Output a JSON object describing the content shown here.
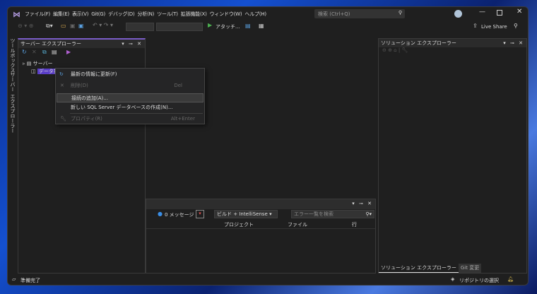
{
  "menu": [
    "ファイル(F)",
    "編集(E)",
    "表示(V)",
    "Git(G)",
    "デバッグ(D)",
    "分析(N)",
    "ツール(T)",
    "拡張機能(X)",
    "ウィンドウ(W)",
    "ヘルプ(H)"
  ],
  "search_placeholder": "検索 (Ctrl+Q)",
  "toolbar": {
    "attach": "アタッチ...",
    "live_share": "Live Share"
  },
  "side_tabs": [
    "ツールボックス",
    "サーバー エクスプローラー"
  ],
  "server_explorer": {
    "title": "サーバー エクスプローラー",
    "tree": [
      "サーバー",
      "データ接続"
    ]
  },
  "context_menu": [
    {
      "label": "最新の情報に更新(F)",
      "shortcut": "",
      "disabled": false
    },
    {
      "label": "削除(D)",
      "shortcut": "Del",
      "disabled": true
    },
    {
      "label": "接続の追加(A)...",
      "shortcut": "",
      "disabled": false
    },
    {
      "label": "新しい SQL Server データベースの作成(N)...",
      "shortcut": "",
      "disabled": false
    },
    {
      "label": "プロパティ(R)",
      "shortcut": "Alt+Enter",
      "disabled": true
    }
  ],
  "error_list": {
    "messages": "0 メッセージ",
    "filter": "ビルド + IntelliSense",
    "search_placeholder": "エラー一覧を検索",
    "columns": [
      "プロジェクト",
      "ファイル",
      "行"
    ]
  },
  "solution_explorer": {
    "title": "ソリューション エクスプローラー",
    "tabs": [
      "ソリューション エクスプローラー",
      "Git 変更"
    ]
  },
  "status": {
    "text": "準備完了",
    "repo": "リポジトリの選択"
  }
}
